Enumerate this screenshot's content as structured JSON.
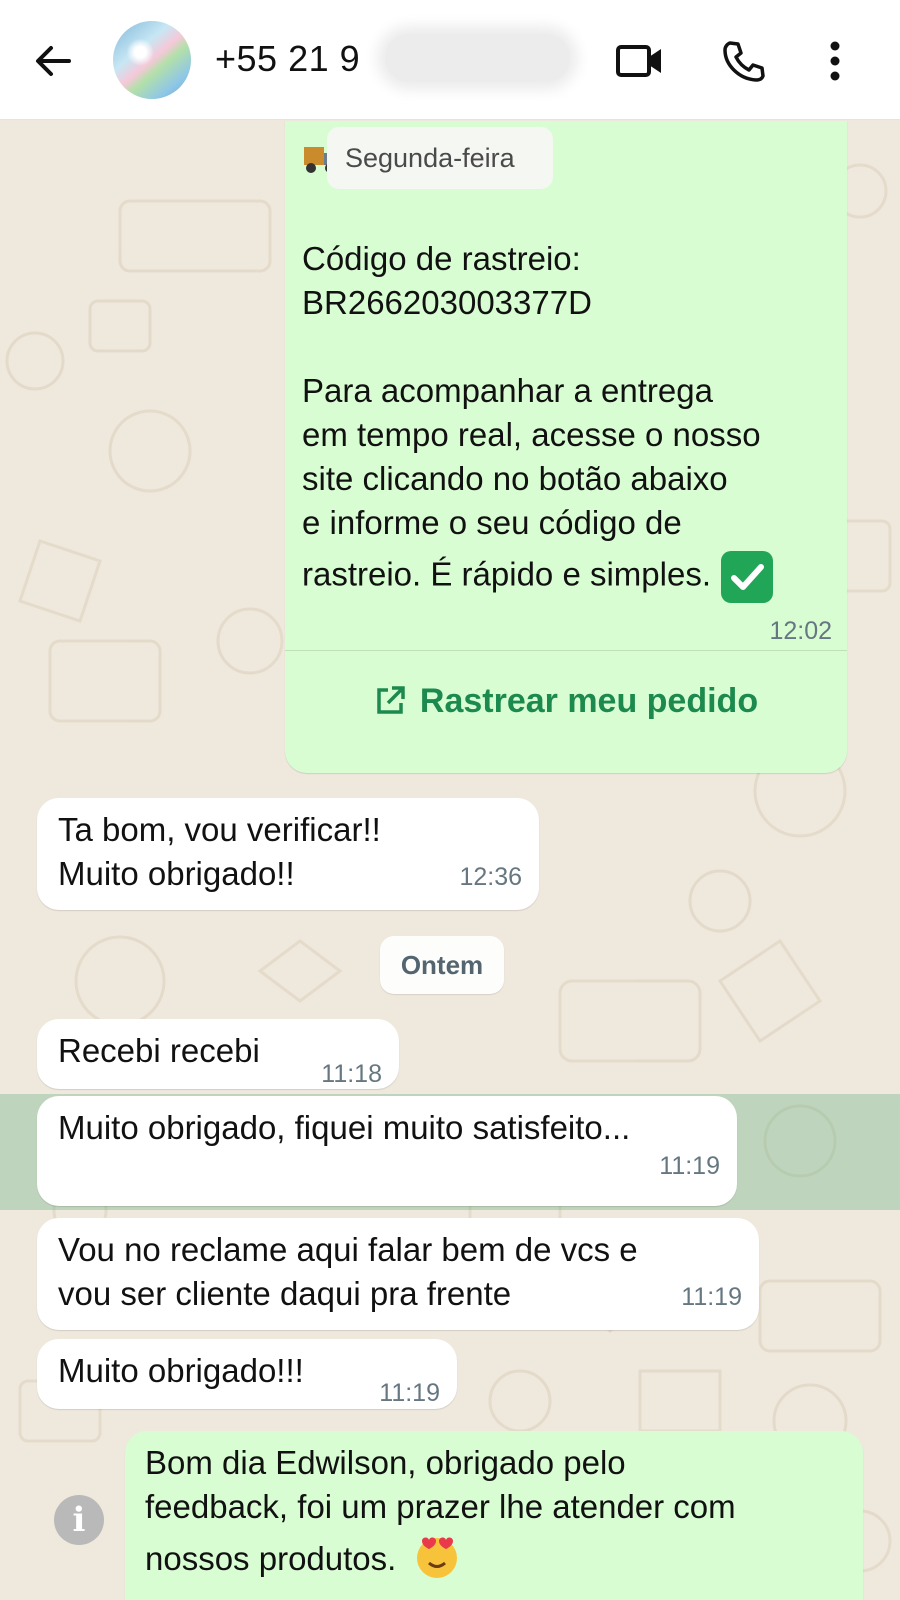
{
  "header": {
    "contact_title": "+55 21 9",
    "icons": [
      "back-arrow-icon",
      "video-call-icon",
      "voice-call-icon",
      "more-options-icon"
    ]
  },
  "messages": {
    "order_card": {
      "badge": "Segunda-feira",
      "line1": "Código de rastreio:",
      "line2": "BR266203003377D",
      "para1": "Para acompanhar a entrega",
      "para2": "em tempo real, acesse o nosso",
      "para3": "site clicando no botão abaixo",
      "para4": "e informe o seu código de",
      "para5": "rastreio. É rápido e simples.",
      "time": "12:02",
      "cta_label": "Rastrear meu pedido"
    },
    "m1": {
      "line1": "Ta bom, vou verificar!!",
      "line2": "Muito obrigado!!",
      "time": "12:36"
    },
    "date_chip": "Ontem",
    "m2": {
      "text": "Recebi recebi",
      "time": "11:18"
    },
    "m3": {
      "text": "Muito obrigado, fiquei muito satisfeito...",
      "time": "11:19"
    },
    "m4": {
      "line1": "Vou no reclame aqui falar bem de vcs e",
      "line2": "vou ser cliente daqui pra frente",
      "time": "11:19"
    },
    "m5": {
      "text": "Muito obrigado!!!",
      "time": "11:19"
    },
    "m6": {
      "line1": "Bom dia Edwilson, obrigado pelo",
      "line2": "feedback, foi um prazer lhe atender com",
      "line3": "nossos produtos."
    }
  },
  "colors": {
    "header_bg": "#ffffff",
    "chat_bg": "#efe8dd",
    "incoming_bubble": "#ffffff",
    "outgoing_bubble": "#d9fdd3",
    "link_green": "#1c8a4e",
    "timestamp": "#667781"
  }
}
